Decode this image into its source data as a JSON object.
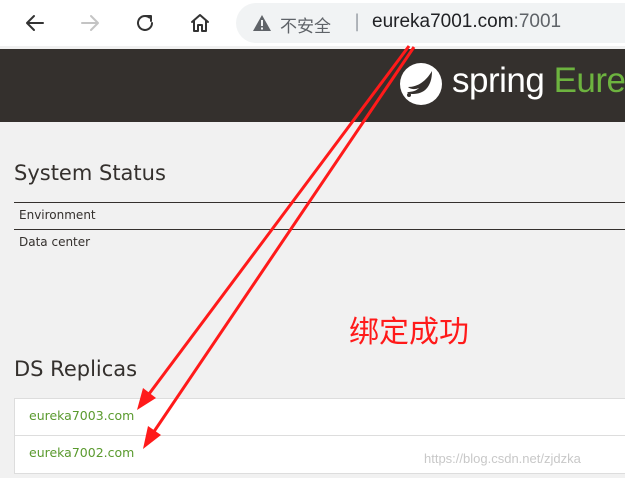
{
  "browser": {
    "insecure_label": "不安全",
    "separator": "|",
    "url_host": "eureka7001.com",
    "url_port": ":7001",
    "icons": [
      "back-arrow-icon",
      "forward-arrow-icon",
      "reload-icon",
      "home-icon",
      "warning-icon"
    ]
  },
  "header": {
    "brand_main": "spring",
    "brand_accent": "Eure",
    "brand_accent_color": "#6db33f",
    "background_color": "#34302d"
  },
  "system_status": {
    "title": "System Status",
    "rows": [
      "Environment",
      "Data center"
    ]
  },
  "ds_replicas": {
    "title": "DS Replicas",
    "items": [
      "eureka7003.com",
      "eureka7002.com"
    ],
    "link_color": "#5a9a2e"
  },
  "annotation": {
    "text": "绑定成功",
    "color": "#ff1a1a"
  },
  "watermark": "https://blog.csdn.net/zjdzka"
}
